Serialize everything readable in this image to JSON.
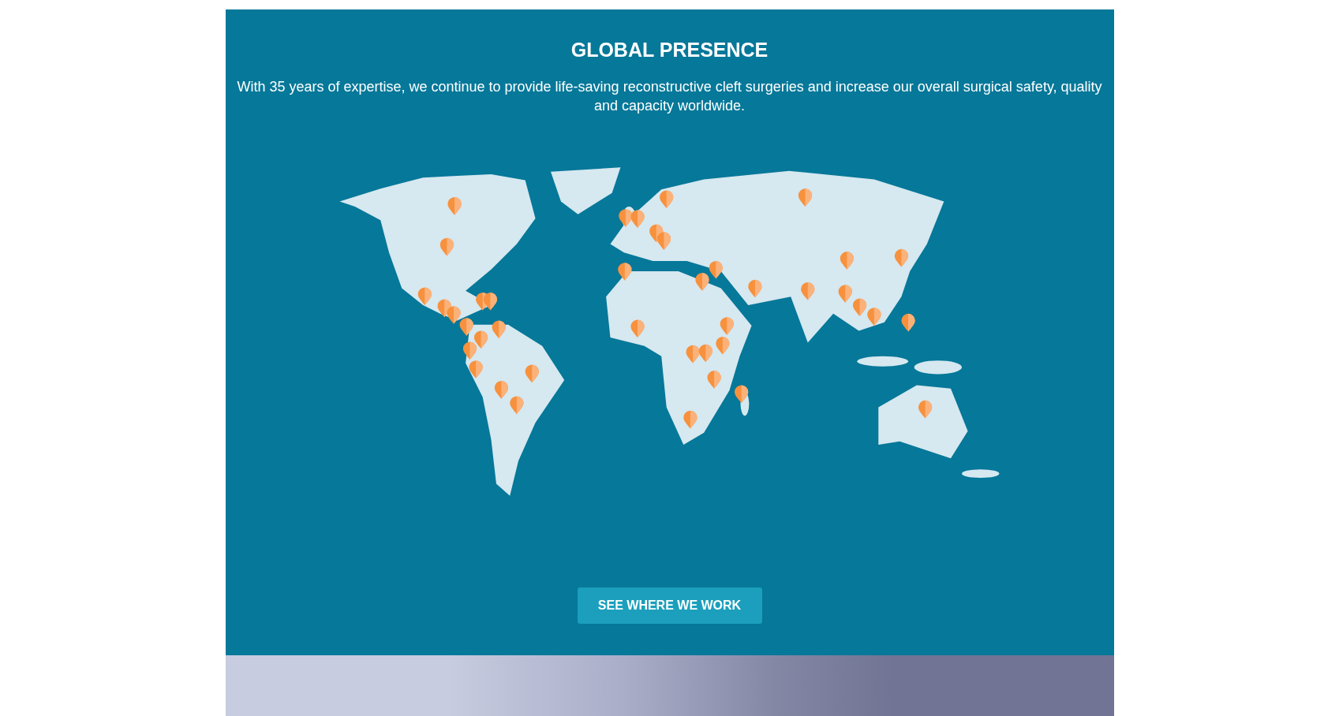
{
  "section": {
    "title": "GLOBAL PRESENCE",
    "description": "With 35 years of expertise, we continue to provide life-saving reconstructive cleft surgeries and increase our overall surgical safety, quality and capacity worldwide.",
    "button": "SEE WHERE WE WORK"
  }
}
